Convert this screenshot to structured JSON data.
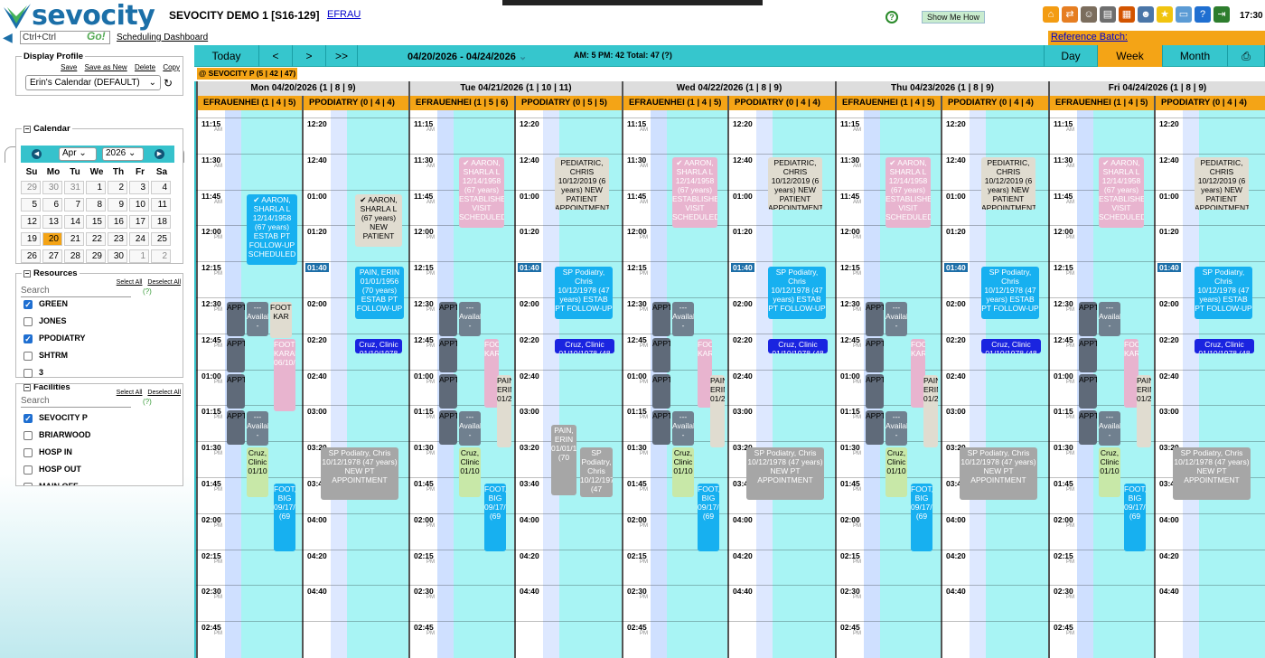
{
  "header": {
    "logo_text": "sevocity",
    "practice_title": "SEVOCITY DEMO 1 [S16-129]",
    "user_link": "EFRAU",
    "help_mark": "?",
    "show_me_label": "Show Me How",
    "clock": "17:30"
  },
  "toolbar_icons": [
    {
      "name": "home-icon",
      "color": "#f39c12",
      "glyph": "⌂"
    },
    {
      "name": "swap-icon",
      "color": "#e67e22",
      "glyph": "⇄"
    },
    {
      "name": "person-icon",
      "color": "#7b6d5d",
      "glyph": "☺"
    },
    {
      "name": "clipboard-icon",
      "color": "#6e6e6e",
      "glyph": "▤"
    },
    {
      "name": "calendar-icon",
      "color": "#d35400",
      "glyph": "▦"
    },
    {
      "name": "users-icon",
      "color": "#4a76a8",
      "glyph": "☻"
    },
    {
      "name": "star-icon",
      "color": "#f1c40f",
      "glyph": "★"
    },
    {
      "name": "monitor-icon",
      "color": "#5b9bd5",
      "glyph": "▭"
    },
    {
      "name": "help-icon",
      "color": "#1f6fd1",
      "glyph": "?"
    },
    {
      "name": "exit-icon",
      "color": "#2d7d2d",
      "glyph": "⇥"
    }
  ],
  "row2": {
    "search_placeholder": "Ctrl+Ctrl",
    "go_label": "Go!",
    "sched_dashboard": "Scheduling Dashboard",
    "ref_batch_label": "Reference Batch:"
  },
  "display_profile": {
    "title": "Display Profile",
    "links": [
      "Save",
      "Save as New",
      "Delete",
      "Copy"
    ],
    "selected": "Erin's Calendar (DEFAULT)"
  },
  "sidebar_tabs": [
    "▭",
    "▦",
    "⌕",
    "⚙"
  ],
  "calendar": {
    "title": "Calendar",
    "month": "Apr",
    "year": "2026",
    "dow": [
      "Su",
      "Mo",
      "Tu",
      "We",
      "Th",
      "Fr",
      "Sa"
    ],
    "weeks": [
      [
        "29",
        "30",
        "31",
        "1",
        "2",
        "3",
        "4"
      ],
      [
        "5",
        "6",
        "7",
        "8",
        "9",
        "10",
        "11"
      ],
      [
        "12",
        "13",
        "14",
        "15",
        "16",
        "17",
        "18"
      ],
      [
        "19",
        "20",
        "21",
        "22",
        "23",
        "24",
        "25"
      ],
      [
        "26",
        "27",
        "28",
        "29",
        "30",
        "1",
        "2"
      ]
    ],
    "today": "20"
  },
  "resources": {
    "title": "Resources",
    "select_all": "Select All",
    "deselect_all": "Deselect All",
    "search": "Search",
    "help": "(?)",
    "items": [
      {
        "label": "GREEN",
        "checked": true
      },
      {
        "label": "JONES",
        "checked": false
      },
      {
        "label": "PPODIATRY",
        "checked": true
      },
      {
        "label": "SHTRM",
        "checked": false
      },
      {
        "label": "3",
        "checked": false
      }
    ]
  },
  "facilities": {
    "title": "Facilities",
    "select_all": "Select All",
    "deselect_all": "Deselect All",
    "search": "Search",
    "help": "(?)",
    "items": [
      {
        "label": "SEVOCITY P",
        "checked": true
      },
      {
        "label": "BRIARWOOD",
        "checked": false
      },
      {
        "label": "HOSP IN",
        "checked": false
      },
      {
        "label": "HOSP OUT",
        "checked": false
      },
      {
        "label": "MAIN OFF",
        "checked": false
      }
    ]
  },
  "navbar": {
    "today": "Today",
    "prev": "<",
    "next": ">",
    "next2": ">>",
    "range": "04/20/2026 - 04/24/2026",
    "counts": "AM: 5 PM: 42 Total: 47  (?)",
    "day": "Day",
    "week": "Week",
    "month": "Month",
    "print": "⎙"
  },
  "facility_tag": "@ SEVOCITY P (5 | 42 | 47)",
  "times_left": [
    {
      "t": "11:15",
      "p": "AM"
    },
    {
      "t": "11:30",
      "p": "AM"
    },
    {
      "t": "11:45",
      "p": "AM"
    },
    {
      "t": "12:00",
      "p": "PM"
    },
    {
      "t": "12:15",
      "p": "PM"
    },
    {
      "t": "12:30",
      "p": "PM"
    },
    {
      "t": "12:45",
      "p": "PM"
    },
    {
      "t": "01:00",
      "p": "PM"
    },
    {
      "t": "01:15",
      "p": "PM"
    },
    {
      "t": "01:30",
      "p": "PM"
    },
    {
      "t": "01:45",
      "p": "PM"
    },
    {
      "t": "02:00",
      "p": "PM"
    },
    {
      "t": "02:15",
      "p": "PM"
    },
    {
      "t": "02:30",
      "p": "PM"
    },
    {
      "t": "02:45",
      "p": "PM"
    }
  ],
  "times_right": [
    "12:20",
    "12:40",
    "01:00",
    "01:20",
    "01:40",
    "02:00",
    "02:20",
    "02:40",
    "03:00",
    "03:20",
    "03:40",
    "04:00",
    "04:20",
    "04:40"
  ],
  "days": [
    {
      "title": "Mon 04/20/2026 (1 | 8 | 9)",
      "p1": "EFRAUENHEI (1 | 4 | 5)",
      "p2": "PPODIATRY (0 | 4 | 4)"
    },
    {
      "title": "Tue 04/21/2026 (1 | 10 | 11)",
      "p1": "EFRAUENHEI (1 | 5 | 6)",
      "p2": "PPODIATRY (0 | 5 | 5)"
    },
    {
      "title": "Wed 04/22/2026 (1 | 8 | 9)",
      "p1": "EFRAUENHEI (1 | 4 | 5)",
      "p2": "PPODIATRY (0 | 4 | 4)"
    },
    {
      "title": "Thu 04/23/2026 (1 | 8 | 9)",
      "p1": "EFRAUENHEI (1 | 4 | 5)",
      "p2": "PPODIATRY (0 | 4 | 4)"
    },
    {
      "title": "Fri 04/24/2026 (1 | 8 | 9)",
      "p1": "EFRAUENHEI (1 | 4 | 5)",
      "p2": "PPODIATRY (0 | 4 | 4)"
    }
  ],
  "appointments": {
    "aaron_mon": "✔ AARON, SHARLA L 12/14/1958 (67 years) ESTAB PT FOLLOW-UP SCHEDULED",
    "aaron_other": "✔ AARON, SHARLA L 12/14/1958 (67 years) ESTABLISHED VISIT SCHEDULED",
    "aaron_pod": "✔ AARON, SHARLA L (67 years) NEW PATIENT",
    "pediatric": "PEDIATRIC, CHRIS 10/12/2019 (6 years) NEW PATIENT APPOINTMENT",
    "pain": "PAIN, ERIN 01/01/1956 (70 years) ESTAB PT FOLLOW-UP",
    "sp_podiatry": "SP Podiatry, Chris 10/12/1978 (47 years) ESTAB PT FOLLOW-UP",
    "cruz_clinic": "Cruz, Clinic 01/10/1978 (48",
    "appt": "APPT",
    "available": "--- Available -",
    "foote_kar": "FOOTE, KAR",
    "foote_karand": "FOOTE, KARAND 06/10/1943",
    "cruz_side": "Cruz, Clinic 01/10",
    "foot_big": "FOOT, BIG 09/17/1956 (69",
    "sp_podiatry2": "SP Podiatry, Chris 10/12/1978 (47 years) NEW PT APPOINTMENT",
    "pain_short": "PAIN, ERIN 01/01/1956 (70",
    "sp_short": "SP Podiatry, Chris 10/12/1978 (47",
    "pain_tall": "PAIN, ERIN 01/21/"
  }
}
